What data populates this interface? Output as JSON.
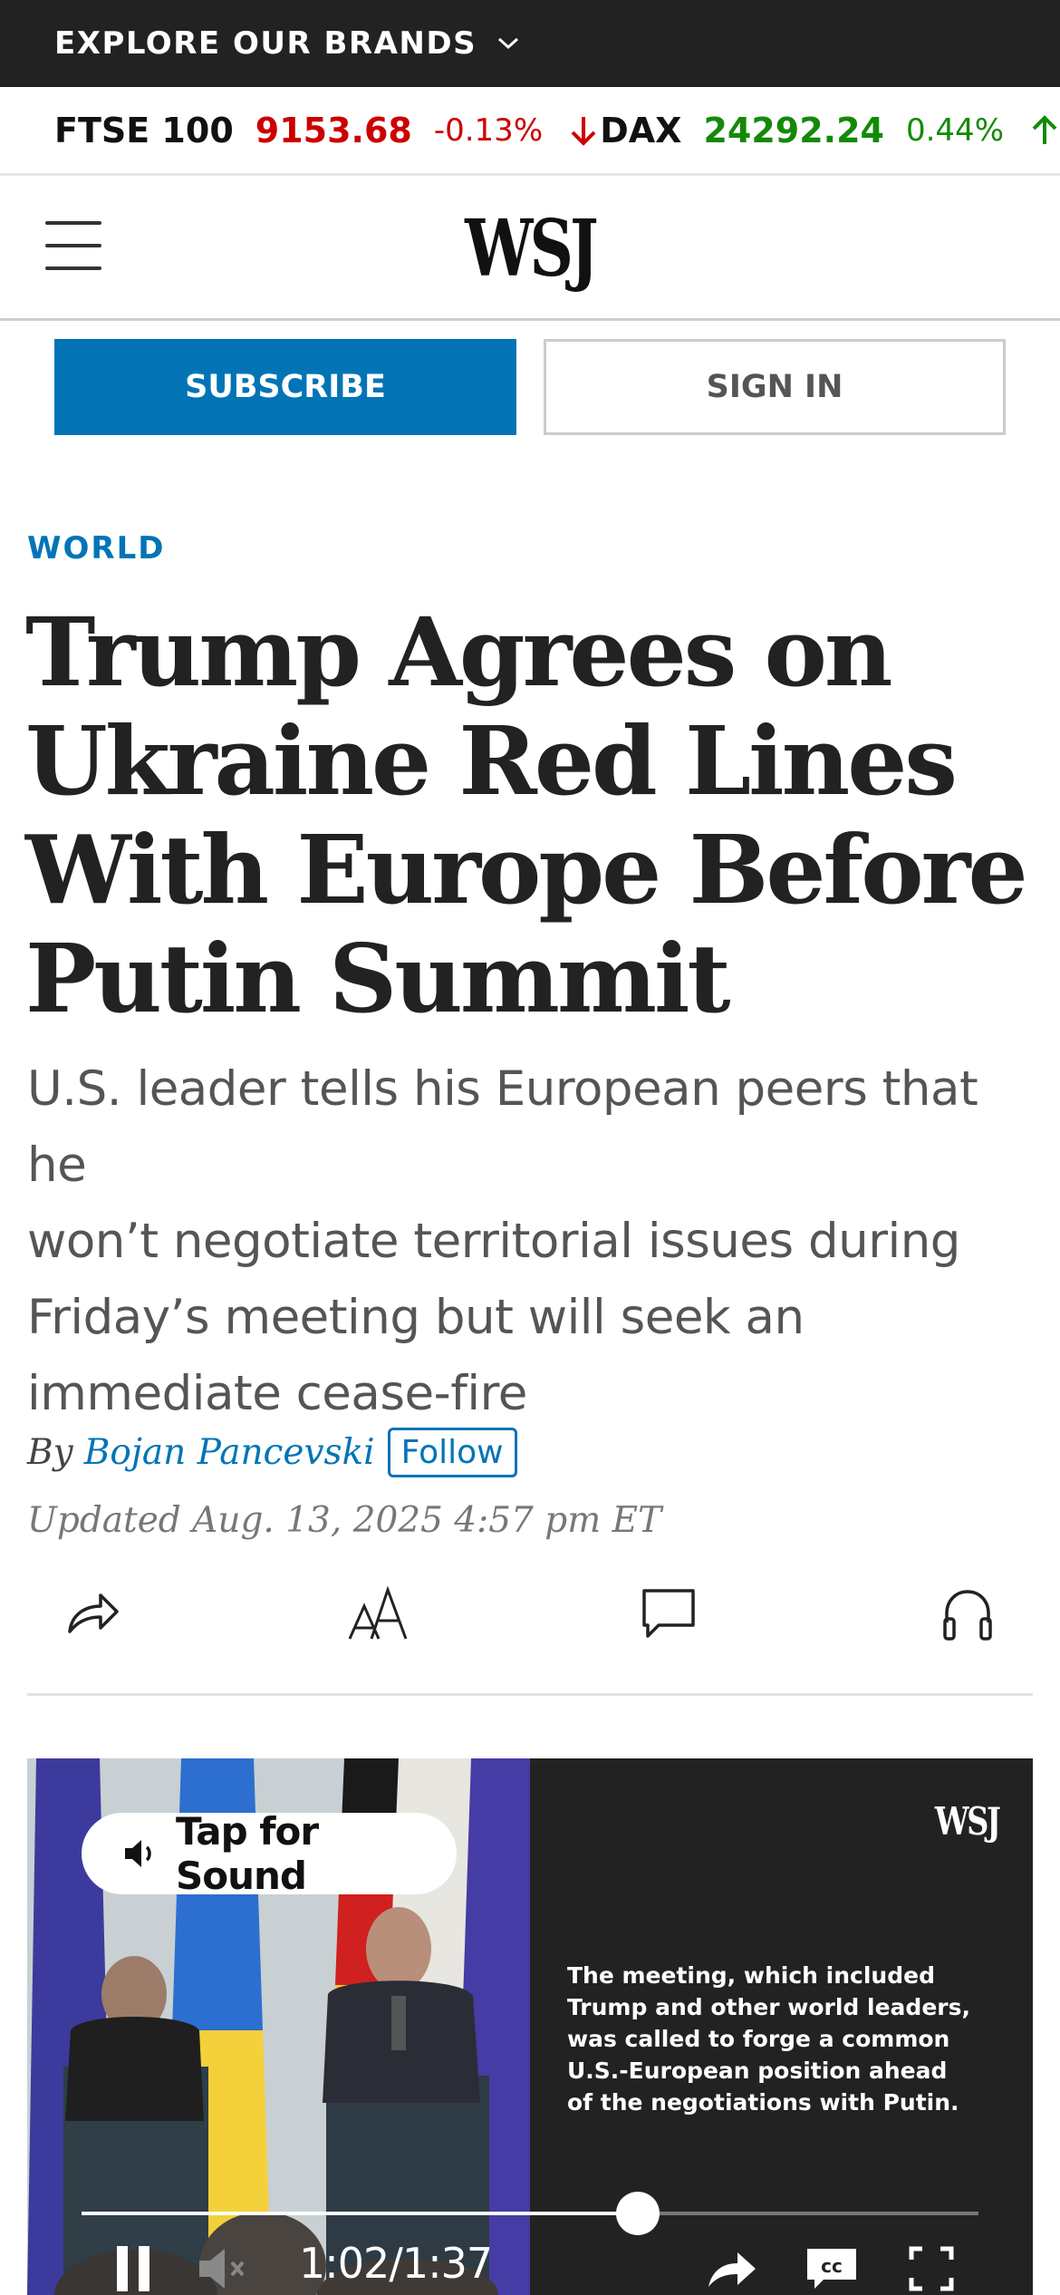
{
  "brand_bar": {
    "label": "EXPLORE OUR BRANDS"
  },
  "ticker": [
    {
      "name": "FTSE 100",
      "value": "9153.68",
      "change": "-0.13%",
      "direction": "down",
      "color": "#cc0000"
    },
    {
      "name": "DAX",
      "value": "24292.24",
      "change": "0.44%",
      "direction": "up",
      "color": "#138a07"
    }
  ],
  "masthead": {
    "logo": "WSJ",
    "menu_icon": "hamburger-menu-icon"
  },
  "auth": {
    "subscribe_label": "SUBSCRIBE",
    "signin_label": "SIGN IN"
  },
  "article": {
    "section": "WORLD",
    "headline_lines": [
      "Trump Agrees on",
      "Ukraine Red Lines",
      "With Europe Before",
      "Putin Summit"
    ],
    "dek_lines": [
      "U.S. leader tells his European peers that he",
      "won’t negotiate territorial issues during",
      "Friday’s meeting but will seek an",
      "immediate cease-fire"
    ],
    "byline_prefix": "By",
    "author": "Bojan Pancevski",
    "follow_label": "Follow",
    "updated": "Updated Aug. 13, 2025 4:57 pm ET"
  },
  "tools": [
    "share-icon",
    "text-size-icon",
    "comments-icon",
    "listen-headphones-icon"
  ],
  "video": {
    "logo": "WSJ",
    "tap_for_sound": "Tap for Sound",
    "caption_lines": [
      "The meeting, which included",
      "Trump and other world leaders,",
      "was called to forge a common",
      "U.S.-European position ahead",
      "of the negotiations with Putin."
    ],
    "current_time": "1:02",
    "duration": "1:37",
    "progress": 0.62
  }
}
